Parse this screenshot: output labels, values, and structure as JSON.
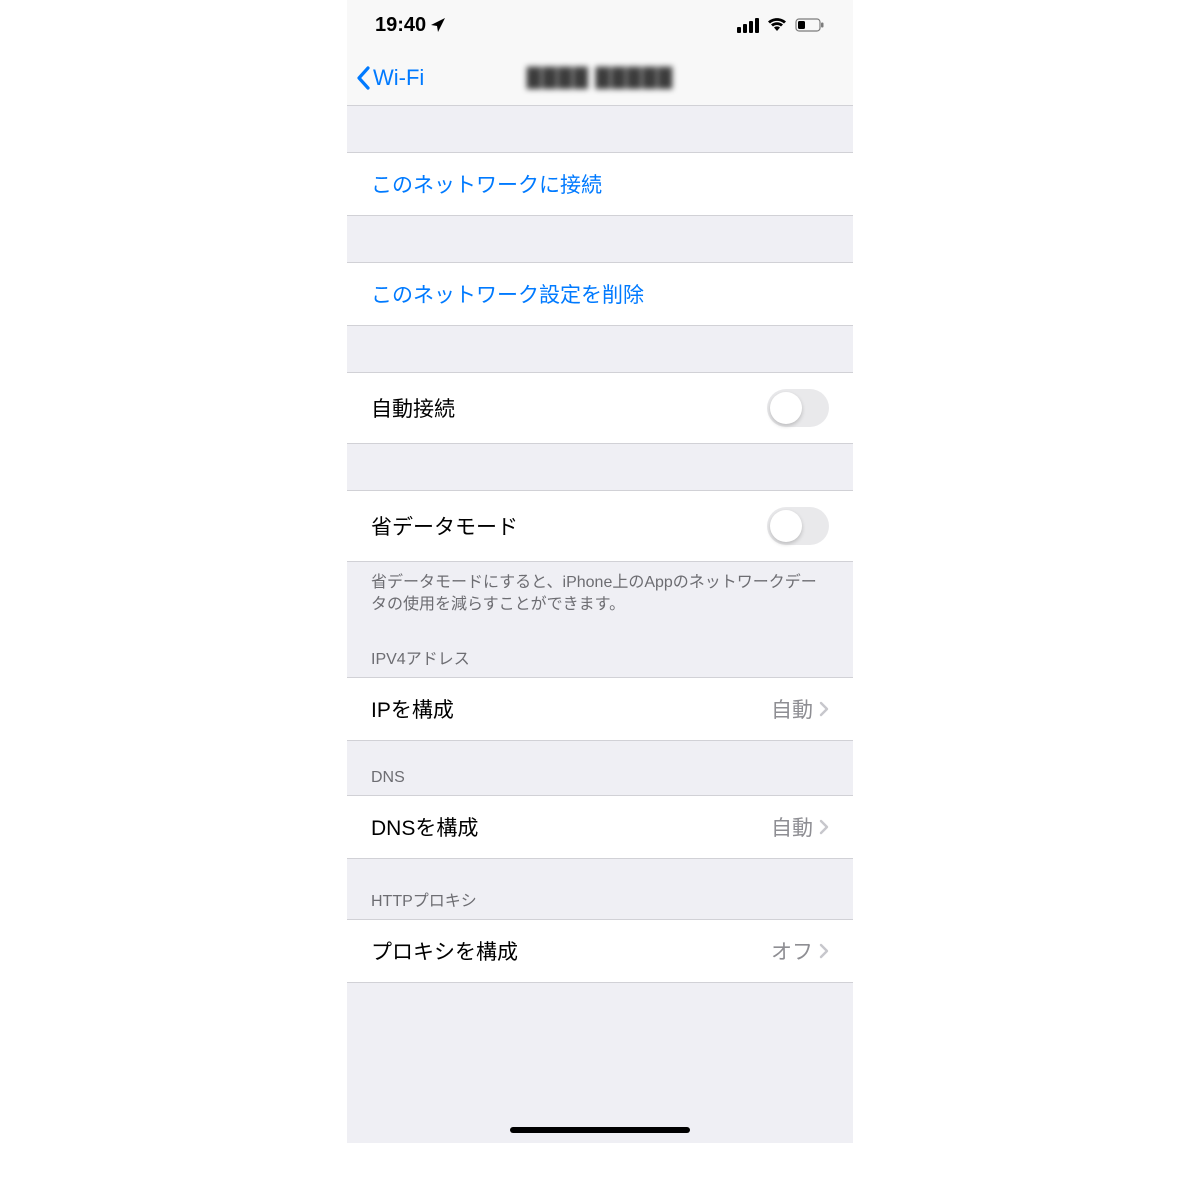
{
  "status": {
    "time": "19:40"
  },
  "nav": {
    "back_label": "Wi-Fi",
    "title": "▓▓▓▓ ▓▓▓▓▓"
  },
  "cells": {
    "join": "このネットワークに接続",
    "forget": "このネットワーク設定を削除",
    "auto_join_label": "自動接続",
    "low_data_label": "省データモード",
    "ip_configure_label": "IPを構成",
    "ip_configure_value": "自動",
    "dns_configure_label": "DNSを構成",
    "dns_configure_value": "自動",
    "proxy_configure_label": "プロキシを構成",
    "proxy_configure_value": "オフ"
  },
  "footers": {
    "low_data": "省データモードにすると、iPhone上のAppのネットワークデータの使用を減らすことができます。"
  },
  "headers": {
    "ipv4": "IPV4アドレス",
    "dns": "DNS",
    "proxy": "HTTPプロキシ"
  }
}
